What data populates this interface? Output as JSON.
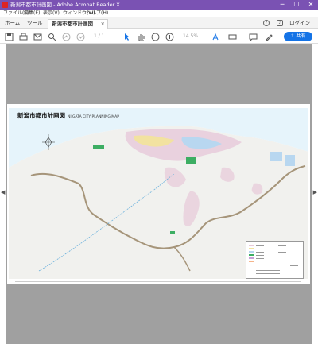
{
  "window": {
    "title": "新潟市都市計画図 - Adobe Acrobat Reader X",
    "controls": [
      "─",
      "☐",
      "✕"
    ]
  },
  "menubar": {
    "items": [
      "ファイル(F)",
      "編集(E)",
      "表示(V)",
      "ウィンドウ(W)",
      "ヘルプ(H)"
    ]
  },
  "tabs": {
    "home": "ホーム",
    "tools": "ツール",
    "document": "新潟市都市計画図",
    "document_close": "×",
    "login": "ログイン"
  },
  "toolbar": {
    "page_indicator": "1 / 1",
    "zoom": "14.5%",
    "share": "共有",
    "icons": [
      "save-icon",
      "print-icon",
      "email-icon",
      "search-icon",
      "page-up-icon",
      "page-down-icon",
      "select-arrow-icon",
      "hand-icon",
      "zoom-out-icon",
      "zoom-in-icon",
      "fit-page-icon",
      "keyboard-icon",
      "comment-icon",
      "pen-icon"
    ]
  },
  "document": {
    "title": "新潟市都市計画図",
    "subtitle": "NIIGATA CITY PLANNING MAP"
  },
  "colors": {
    "titlebar": "#7a52b3",
    "share_button": "#1473e6",
    "viewer_bg": "#a0a0a0",
    "sea": "#e6f4fb",
    "land": "#f1f1ee",
    "urban": "#e7c9d9",
    "green": "#3dae63",
    "boundary": "#a6957a"
  }
}
